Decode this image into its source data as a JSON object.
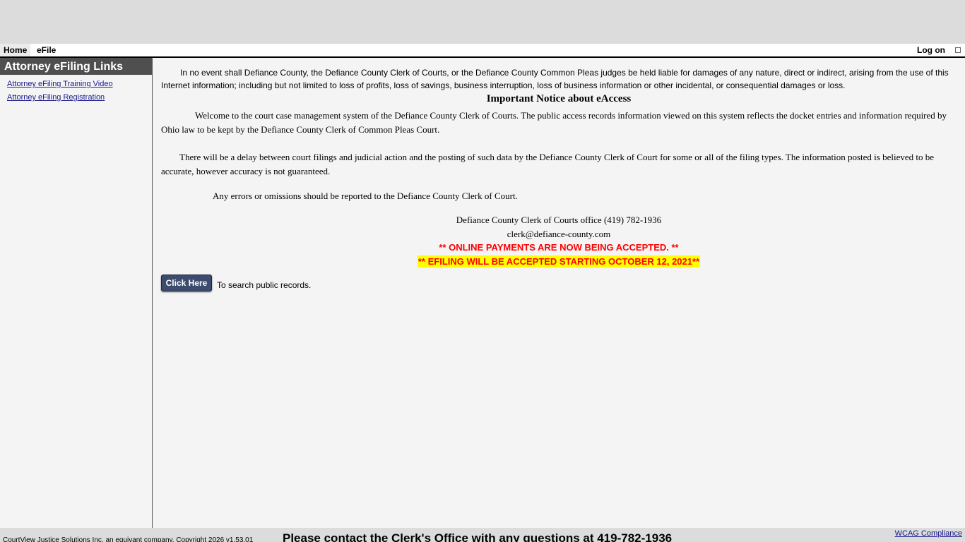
{
  "nav": {
    "home": "Home",
    "efile": "eFile",
    "logon": "Log on"
  },
  "sidebar": {
    "title": "Attorney eFiling Links",
    "links": [
      {
        "label": "Attorney eFiling Training Video"
      },
      {
        "label": "Attorney eFiling Registration"
      }
    ]
  },
  "main": {
    "disclaimer": "In no event shall Defiance County, the Defiance County Clerk of Courts, or the Defiance County Common Pleas judges be held liable for damages of any nature, direct or indirect, arising from the use of this Internet information; including but not limited to loss of profits, loss of savings, business interruption, loss of business information or other incidental, or consequential damages or loss.",
    "notice_title": "Important Notice about eAccess",
    "paragraph1": "Welcome to the court case management system of the Defiance County Clerk of Courts. The public access records information viewed on this system reflects the docket entries and information required by Ohio law to be kept by the Defiance County Clerk of Common Pleas Court.",
    "paragraph2": "There will be a delay between court filings and judicial action and the posting of such data by the Defiance County Clerk of Court for some or all of the filing types. The information posted is believed to be accurate, however accuracy is not guaranteed.",
    "paragraph3": "Any errors or omissions should be reported to the Defiance County Clerk of Court.",
    "office_line": "Defiance County Clerk of Courts office (419) 782-1936",
    "email": "clerk@defiance-county.com",
    "payments_notice": "** ONLINE PAYMENTS ARE NOW BEING ACCEPTED. **",
    "efiling_notice": "** EFILING WILL BE ACCEPTED STARTING OCTOBER 12, 2021**",
    "search_button": "Click Here",
    "search_text": "To search public records."
  },
  "footer": {
    "copyright": "CourtView Justice Solutions Inc. an equivant company. Copyright 2026 v1.53.01",
    "contact": "Please contact the Clerk's Office with any questions at 419-782-1936",
    "wcag": "WCAG Compliance"
  },
  "colors": {
    "sidebar_header": "#4f4f4f",
    "button": "#3c4b6e",
    "alert_red": "#ff0000",
    "highlight_yellow": "#ffff00",
    "link": "#1a1a8c"
  }
}
